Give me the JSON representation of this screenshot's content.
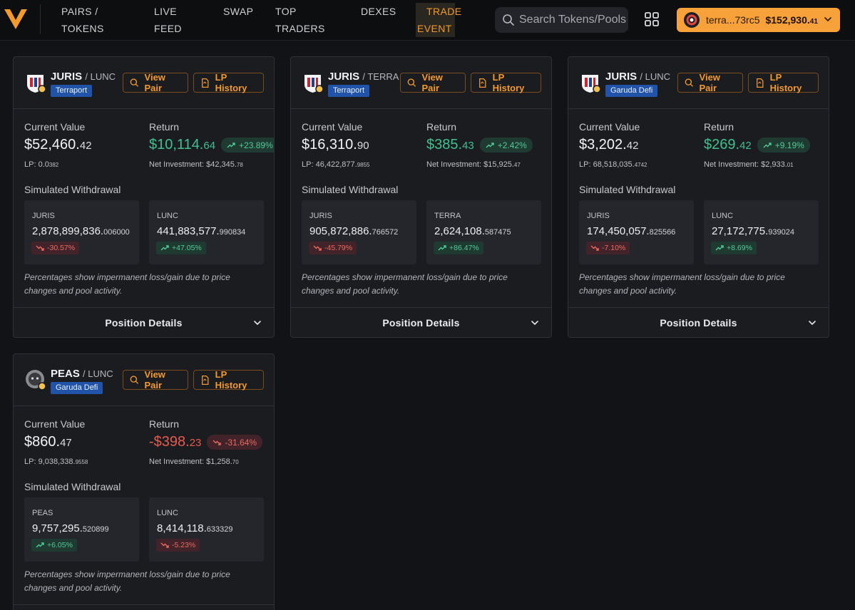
{
  "nav": {
    "items": [
      {
        "line1": "PAIRS /",
        "line2": "TOKENS"
      },
      {
        "line1": "LIVE",
        "line2": "FEED"
      },
      {
        "line1": "SWAP",
        "line2": ""
      },
      {
        "line1": "TOP",
        "line2": "TRADERS"
      },
      {
        "line1": "DEXES",
        "line2": ""
      },
      {
        "line1": "TRADE",
        "line2": "EVENT"
      }
    ],
    "active_index": 5
  },
  "search": {
    "placeholder": "Search Tokens/Pools"
  },
  "wallet": {
    "address": "terra...73rc5",
    "balance_main": "$152,930.",
    "balance_dec": "41"
  },
  "labels": {
    "view_pair": "View Pair",
    "lp_history": "LP History",
    "current_value": "Current Value",
    "return": "Return",
    "simulated_withdrawal": "Simulated Withdrawal",
    "note": "Percentages show impermanent loss/gain due to price changes and pool activity.",
    "position_details": "Position Details",
    "lp_prefix": "LP: ",
    "net_prefix": "Net Investment: "
  },
  "colors": {
    "accent": "#f39a2d",
    "positive": "#3fc08f",
    "negative": "#e85a4f",
    "badge": "#2154a8"
  },
  "cards": [
    {
      "base": "JURIS",
      "quote": "/ LUNC",
      "dex": "Terraport",
      "current_value": {
        "main": "$52,460.",
        "dec": "42"
      },
      "return": {
        "main": "$10,114.",
        "dec": "64",
        "sign": "pos",
        "pct": "+23.89%"
      },
      "lp": {
        "main": "0.0",
        "sub": "3",
        "rest": "82"
      },
      "net_investment": {
        "main": "$42,345.",
        "dec": "78"
      },
      "withdraw": [
        {
          "symbol": "JURIS",
          "main": "2,878,899,836.",
          "dec": "006000",
          "pct": "-30.57%",
          "sign": "neg"
        },
        {
          "symbol": "LUNC",
          "main": "441,883,577.",
          "dec": "990834",
          "pct": "+47.05%",
          "sign": "pos"
        }
      ]
    },
    {
      "base": "JURIS",
      "quote": "/ TERRA",
      "dex": "Terraport",
      "current_value": {
        "main": "$16,310.",
        "dec": "90"
      },
      "return": {
        "main": "$385.",
        "dec": "43",
        "sign": "pos",
        "pct": "+2.42%"
      },
      "lp": {
        "main": "46,422,877.",
        "sub": "",
        "rest": "9855"
      },
      "net_investment": {
        "main": "$15,925.",
        "dec": "47"
      },
      "withdraw": [
        {
          "symbol": "JURIS",
          "main": "905,872,886.",
          "dec": "766572",
          "pct": "-45.79%",
          "sign": "neg"
        },
        {
          "symbol": "TERRA",
          "main": "2,624,108.",
          "dec": "587475",
          "pct": "+86.47%",
          "sign": "pos"
        }
      ]
    },
    {
      "base": "JURIS",
      "quote": "/ LUNC",
      "dex": "Garuda Defi",
      "current_value": {
        "main": "$3,202.",
        "dec": "42"
      },
      "return": {
        "main": "$269.",
        "dec": "42",
        "sign": "pos",
        "pct": "+9.19%"
      },
      "lp": {
        "main": "68,518,035.",
        "sub": "",
        "rest": "4742"
      },
      "net_investment": {
        "main": "$2,933.",
        "dec": "01"
      },
      "withdraw": [
        {
          "symbol": "JURIS",
          "main": "174,450,057.",
          "dec": "825566",
          "pct": "-7.10%",
          "sign": "neg"
        },
        {
          "symbol": "LUNC",
          "main": "27,172,775.",
          "dec": "939024",
          "pct": "+8.69%",
          "sign": "pos"
        }
      ]
    },
    {
      "base": "PEAS",
      "quote": "/ LUNC",
      "dex": "Garuda Defi",
      "current_value": {
        "main": "$860.",
        "dec": "47"
      },
      "return": {
        "main": "-$398.",
        "dec": "23",
        "sign": "neg",
        "pct": "-31.64%"
      },
      "lp": {
        "main": "9,038,338.",
        "sub": "",
        "rest": "9558"
      },
      "net_investment": {
        "main": "$1,258.",
        "dec": "70"
      },
      "withdraw": [
        {
          "symbol": "PEAS",
          "main": "9,757,295.",
          "dec": "520899",
          "pct": "+6.05%",
          "sign": "pos"
        },
        {
          "symbol": "LUNC",
          "main": "8,414,118.",
          "dec": "633329",
          "pct": "-5.23%",
          "sign": "neg"
        }
      ]
    }
  ]
}
